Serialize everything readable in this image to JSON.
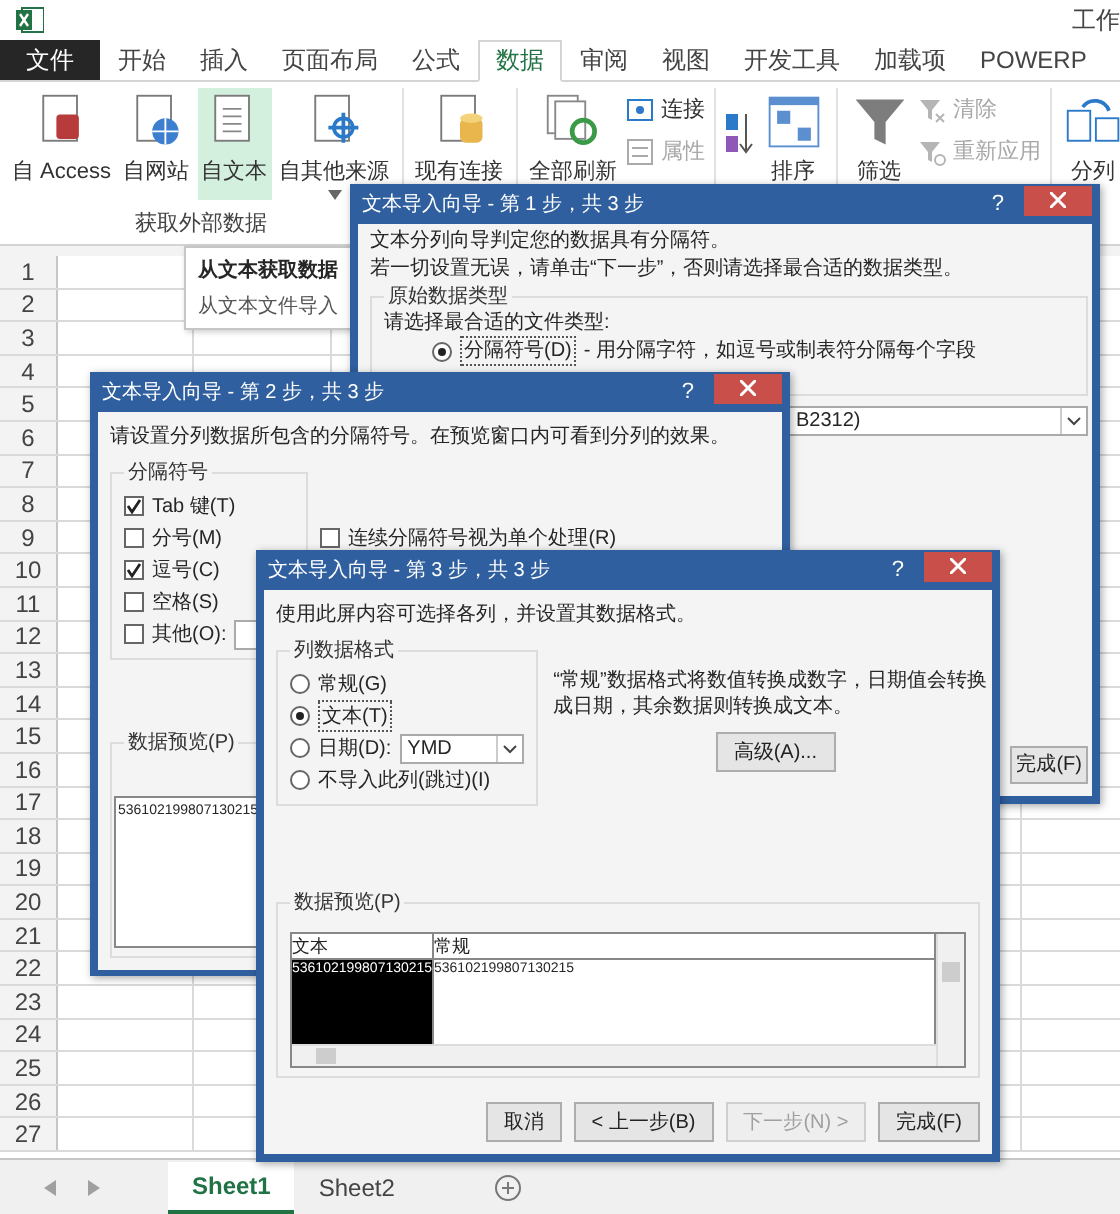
{
  "app_title": "工作",
  "ribbon_tabs": [
    {
      "label": "文件",
      "kind": "file",
      "selected": false
    },
    {
      "label": "开始",
      "kind": "tab",
      "selected": false
    },
    {
      "label": "插入",
      "kind": "tab",
      "selected": false
    },
    {
      "label": "页面布局",
      "kind": "tab",
      "selected": false
    },
    {
      "label": "公式",
      "kind": "tab",
      "selected": false
    },
    {
      "label": "数据",
      "kind": "tab",
      "selected": true
    },
    {
      "label": "审阅",
      "kind": "tab",
      "selected": false
    },
    {
      "label": "视图",
      "kind": "tab",
      "selected": false
    },
    {
      "label": "开发工具",
      "kind": "tab",
      "selected": false
    },
    {
      "label": "加载项",
      "kind": "tab",
      "selected": false
    },
    {
      "label": "POWERP",
      "kind": "tab",
      "selected": false
    }
  ],
  "ribbon_groups": [
    {
      "label": "获取外部数据",
      "items": [
        {
          "kind": "large",
          "label": "自 Access",
          "hovered": false
        },
        {
          "kind": "large",
          "label": "自网站",
          "hovered": false
        },
        {
          "kind": "large",
          "label": "自文本",
          "hovered": true
        },
        {
          "kind": "large",
          "label": "自其他来源",
          "hovered": false,
          "menu": true
        }
      ]
    },
    {
      "items": [
        {
          "kind": "large",
          "label": "现有连接",
          "hovered": false
        }
      ]
    },
    {
      "items": [
        {
          "kind": "large",
          "label": "全部刷新",
          "hovered": false
        },
        {
          "kind": "small",
          "label": "连接",
          "disabled": false
        },
        {
          "kind": "small",
          "label": "属性",
          "disabled": true
        }
      ]
    },
    {
      "items": [
        {
          "kind": "icon"
        },
        {
          "kind": "large",
          "label": "排序",
          "hovered": false
        }
      ]
    },
    {
      "items": [
        {
          "kind": "large",
          "label": "筛选",
          "hovered": false
        },
        {
          "kind": "small",
          "label": "清除",
          "disabled": true
        },
        {
          "kind": "small",
          "label": "重新应用",
          "disabled": true
        }
      ]
    },
    {
      "items": [
        {
          "kind": "large",
          "label": "分列",
          "hovered": false
        }
      ]
    }
  ],
  "tooltip": {
    "title": "从文本获取数据",
    "text": "从文本文件导入"
  },
  "sheet": {
    "row_numbers": [
      "1",
      "2",
      "3",
      "4",
      "5",
      "6",
      "7",
      "8",
      "9",
      "10",
      "11",
      "12",
      "13",
      "14",
      "15",
      "16",
      "17",
      "18",
      "19",
      "20",
      "21",
      "22",
      "23",
      "24",
      "25",
      "26",
      "27"
    ]
  },
  "sheet_tabs": [
    {
      "label": "Sheet1",
      "selected": true
    },
    {
      "label": "Sheet2",
      "selected": false
    }
  ],
  "wizard_step1": {
    "title": "文本导入向导 - 第 1 步，共 3 步",
    "help": "?",
    "intro": "文本分列向导判定您的数据具有分隔符。",
    "hint": "若一切设置无误，请单击“下一步”，否则请选择最合适的数据类型。",
    "group_title": "原始数据类型",
    "prompt": "请选择最合适的文件类型:",
    "options": [
      {
        "label": "分隔符号(D)",
        "description": "- 用分隔字符，如逗号或制表符分隔每个字段",
        "selected": true
      }
    ],
    "encoding_value": "B2312)",
    "buttons": [
      {
        "label": "完成(F)",
        "disabled": false
      }
    ]
  },
  "wizard_step2": {
    "title": "文本导入向导 - 第 2 步，共 3 步",
    "help": "?",
    "intro": "请设置分列数据所包含的分隔符号。在预览窗口内可看到分列的效果。",
    "group_title": "分隔符号",
    "delimiters": [
      {
        "label": "Tab 键(T)",
        "checked": true,
        "kind": "plain"
      },
      {
        "label": "分号(M)",
        "checked": false,
        "kind": "plain"
      },
      {
        "label": "逗号(C)",
        "checked": true,
        "kind": "plain"
      },
      {
        "label": "空格(S)",
        "checked": false,
        "kind": "plain"
      },
      {
        "label": "其他(O):",
        "checked": false,
        "kind": "other"
      }
    ],
    "consecutive": {
      "label": "连续分隔符号视为单个处理(R)",
      "checked": false
    },
    "preview_title": "数据预览(P)",
    "preview_rows": [
      "536102199807130215"
    ]
  },
  "wizard_step3": {
    "title": "文本导入向导 - 第 3 步，共 3 步",
    "help": "?",
    "intro": "使用此屏内容可选择各列，并设置其数据格式。",
    "group_title": "列数据格式",
    "formats": [
      {
        "label": "常规(G)",
        "selected": false,
        "kind": "plain"
      },
      {
        "label": "文本(T)",
        "selected": true,
        "kind": "plain"
      },
      {
        "label": "日期(D):",
        "selected": false,
        "kind": "date",
        "value": "YMD"
      },
      {
        "label": "不导入此列(跳过)(I)",
        "selected": false,
        "kind": "plain"
      }
    ],
    "description": "“常规”数据格式将数值转换成数字，日期值会转换成日期，其余数据则转换成文本。",
    "advanced_button": "高级(A)...",
    "preview_title": "数据预览(P)",
    "preview": {
      "columns": [
        {
          "header": "文本",
          "selected": true
        },
        {
          "header": "常规",
          "selected": false
        }
      ],
      "rows": [
        [
          "536102199807130215",
          "536102199807130215"
        ]
      ]
    },
    "buttons": [
      {
        "label": "取消",
        "disabled": false
      },
      {
        "label": "< 上一步(B)",
        "disabled": false
      },
      {
        "label": "下一步(N) >",
        "disabled": true
      },
      {
        "label": "完成(F)",
        "disabled": false
      }
    ]
  }
}
